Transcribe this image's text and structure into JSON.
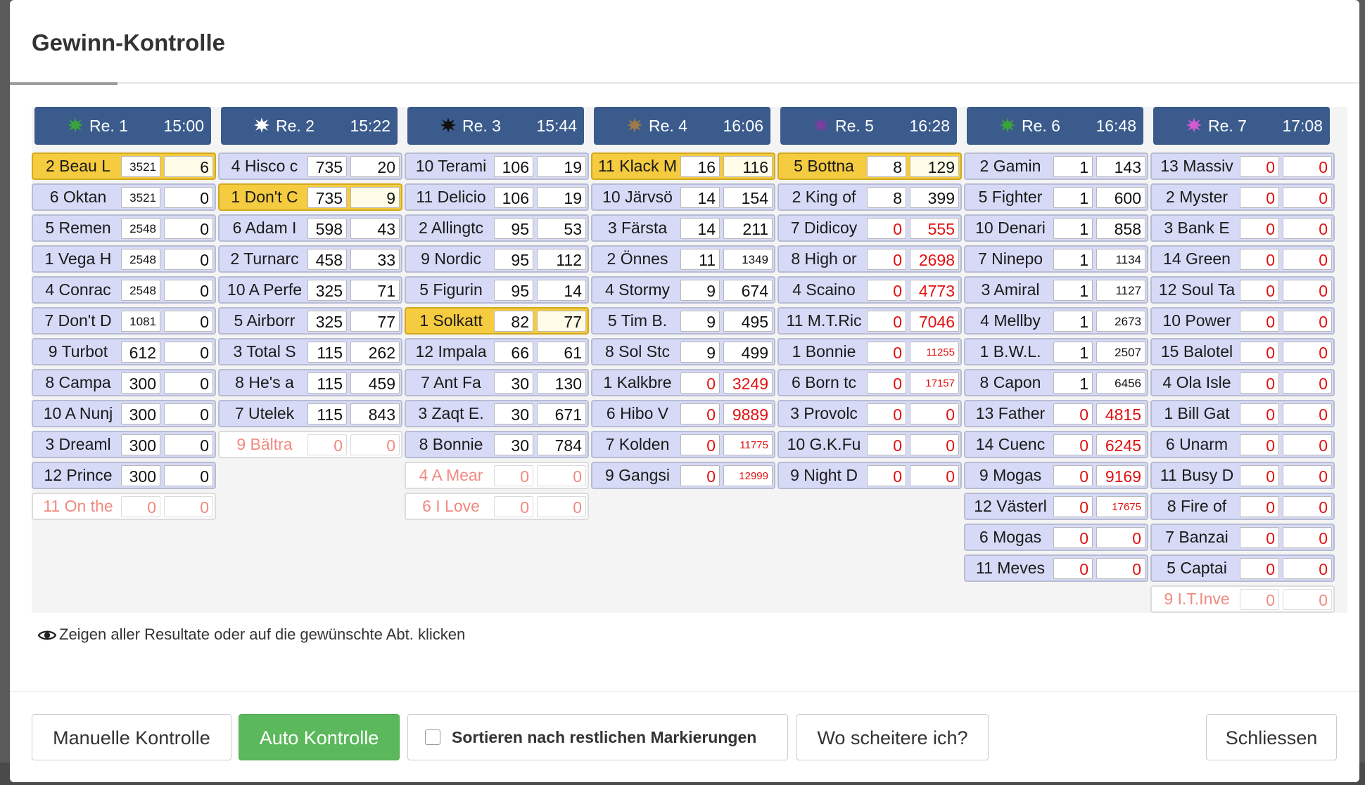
{
  "modal": {
    "title": "Gewinn-Kontrolle",
    "hint": "Zeigen aller Resultate oder auf die gewünschte Abt. klicken"
  },
  "races": [
    {
      "label": "Re. 1",
      "time": "15:00",
      "dot_color": "#3aa43a",
      "rows": [
        {
          "name": "2 Beau L",
          "v1": "3521",
          "v2": "6",
          "state": "winner"
        },
        {
          "name": "6 Oktan",
          "v1": "3521",
          "v2": "0",
          "state": "normal"
        },
        {
          "name": "5 Remen",
          "v1": "2548",
          "v2": "0",
          "state": "normal"
        },
        {
          "name": "1 Vega H",
          "v1": "2548",
          "v2": "0",
          "state": "normal"
        },
        {
          "name": "4 Conrac",
          "v1": "2548",
          "v2": "0",
          "state": "normal"
        },
        {
          "name": "7 Don't D",
          "v1": "1081",
          "v2": "0",
          "state": "normal"
        },
        {
          "name": "9 Turbot",
          "v1": "612",
          "v2": "0",
          "state": "normal"
        },
        {
          "name": "8 Campa",
          "v1": "300",
          "v2": "0",
          "state": "normal"
        },
        {
          "name": "10 A Nunj",
          "v1": "300",
          "v2": "0",
          "state": "normal"
        },
        {
          "name": "3 Dreaml",
          "v1": "300",
          "v2": "0",
          "state": "normal"
        },
        {
          "name": "12 Prince",
          "v1": "300",
          "v2": "0",
          "state": "normal"
        },
        {
          "name": "11 On the",
          "v1": "0",
          "v2": "0",
          "state": "scratched"
        }
      ]
    },
    {
      "label": "Re. 2",
      "time": "15:22",
      "dot_color": "#ffffff",
      "rows": [
        {
          "name": "4 Hisco c",
          "v1": "735",
          "v2": "20",
          "state": "normal"
        },
        {
          "name": "1 Don't C",
          "v1": "735",
          "v2": "9",
          "state": "winner"
        },
        {
          "name": "6 Adam I",
          "v1": "598",
          "v2": "43",
          "state": "normal"
        },
        {
          "name": "2 Turnarc",
          "v1": "458",
          "v2": "33",
          "state": "normal"
        },
        {
          "name": "10 A Perfe",
          "v1": "325",
          "v2": "71",
          "state": "normal"
        },
        {
          "name": "5 Airborr",
          "v1": "325",
          "v2": "77",
          "state": "normal"
        },
        {
          "name": "3 Total S",
          "v1": "115",
          "v2": "262",
          "state": "normal"
        },
        {
          "name": "8 He's a",
          "v1": "115",
          "v2": "459",
          "state": "normal"
        },
        {
          "name": "7 Utelek",
          "v1": "115",
          "v2": "843",
          "state": "normal"
        },
        {
          "name": "9 Bältra",
          "v1": "0",
          "v2": "0",
          "state": "scratched"
        }
      ]
    },
    {
      "label": "Re. 3",
      "time": "15:44",
      "dot_color": "#111111",
      "rows": [
        {
          "name": "10 Terami",
          "v1": "106",
          "v2": "19",
          "state": "normal"
        },
        {
          "name": "11 Delicio",
          "v1": "106",
          "v2": "19",
          "state": "normal"
        },
        {
          "name": "2 Allingtc",
          "v1": "95",
          "v2": "53",
          "state": "normal"
        },
        {
          "name": "9 Nordic",
          "v1": "95",
          "v2": "112",
          "state": "normal"
        },
        {
          "name": "5 Figurin",
          "v1": "95",
          "v2": "14",
          "state": "normal"
        },
        {
          "name": "1 Solkatt",
          "v1": "82",
          "v2": "77",
          "state": "winner"
        },
        {
          "name": "12 Impala",
          "v1": "66",
          "v2": "61",
          "state": "normal"
        },
        {
          "name": "7 Ant Fa",
          "v1": "30",
          "v2": "130",
          "state": "normal"
        },
        {
          "name": "3 Zaqt E.",
          "v1": "30",
          "v2": "671",
          "state": "normal"
        },
        {
          "name": "8 Bonnie",
          "v1": "30",
          "v2": "784",
          "state": "normal"
        },
        {
          "name": "4 A Mear",
          "v1": "0",
          "v2": "0",
          "state": "scratched"
        },
        {
          "name": "6 I Love",
          "v1": "0",
          "v2": "0",
          "state": "scratched"
        }
      ]
    },
    {
      "label": "Re. 4",
      "time": "16:06",
      "dot_color": "#9c7a4a",
      "rows": [
        {
          "name": "11 Klack M",
          "v1": "16",
          "v2": "116",
          "state": "winner"
        },
        {
          "name": "10 Järvsö",
          "v1": "14",
          "v2": "154",
          "state": "normal"
        },
        {
          "name": "3 Färsta",
          "v1": "14",
          "v2": "211",
          "state": "normal"
        },
        {
          "name": "2 Önnes",
          "v1": "11",
          "v2": "1349",
          "state": "normal"
        },
        {
          "name": "4 Stormy",
          "v1": "9",
          "v2": "674",
          "state": "normal"
        },
        {
          "name": "5 Tim B.",
          "v1": "9",
          "v2": "495",
          "state": "normal"
        },
        {
          "name": "8 Sol Stc",
          "v1": "9",
          "v2": "499",
          "state": "normal"
        },
        {
          "name": "1 Kalkbre",
          "v1": "0",
          "v2": "3249",
          "state": "normal"
        },
        {
          "name": "6 Hibo V",
          "v1": "0",
          "v2": "9889",
          "state": "normal"
        },
        {
          "name": "7 Kolden",
          "v1": "0",
          "v2": "11775",
          "state": "normal"
        },
        {
          "name": "9 Gangsi",
          "v1": "0",
          "v2": "12999",
          "state": "normal"
        }
      ]
    },
    {
      "label": "Re. 5",
      "time": "16:28",
      "dot_color": "#7b3fa0",
      "rows": [
        {
          "name": "5 Bottna",
          "v1": "8",
          "v2": "129",
          "state": "winner"
        },
        {
          "name": "2 King of",
          "v1": "8",
          "v2": "399",
          "state": "normal"
        },
        {
          "name": "7 Didicoy",
          "v1": "0",
          "v2": "555",
          "state": "normal"
        },
        {
          "name": "8 High or",
          "v1": "0",
          "v2": "2698",
          "state": "normal"
        },
        {
          "name": "4 Scaino",
          "v1": "0",
          "v2": "4773",
          "state": "normal"
        },
        {
          "name": "11 M.T.Ric",
          "v1": "0",
          "v2": "7046",
          "state": "normal"
        },
        {
          "name": "1 Bonnie",
          "v1": "0",
          "v2": "11255",
          "state": "normal"
        },
        {
          "name": "6 Born tc",
          "v1": "0",
          "v2": "17157",
          "state": "normal"
        },
        {
          "name": "3 Provolc",
          "v1": "0",
          "v2": "0",
          "state": "normal"
        },
        {
          "name": "10 G.K.Fu",
          "v1": "0",
          "v2": "0",
          "state": "normal"
        },
        {
          "name": "9 Night D",
          "v1": "0",
          "v2": "0",
          "state": "normal"
        }
      ]
    },
    {
      "label": "Re. 6",
      "time": "16:48",
      "dot_color": "#3aa43a",
      "rows": [
        {
          "name": "2 Gamin",
          "v1": "1",
          "v2": "143",
          "state": "normal"
        },
        {
          "name": "5 Fighter",
          "v1": "1",
          "v2": "600",
          "state": "normal"
        },
        {
          "name": "10 Denari",
          "v1": "1",
          "v2": "858",
          "state": "normal"
        },
        {
          "name": "7 Ninepo",
          "v1": "1",
          "v2": "1134",
          "state": "normal"
        },
        {
          "name": "3 Amiral",
          "v1": "1",
          "v2": "1127",
          "state": "normal"
        },
        {
          "name": "4 Mellby",
          "v1": "1",
          "v2": "2673",
          "state": "normal"
        },
        {
          "name": "1 B.W.L.",
          "v1": "1",
          "v2": "2507",
          "state": "normal"
        },
        {
          "name": "8 Capon",
          "v1": "1",
          "v2": "6456",
          "state": "normal"
        },
        {
          "name": "13 Father",
          "v1": "0",
          "v2": "4815",
          "state": "normal"
        },
        {
          "name": "14 Cuenc",
          "v1": "0",
          "v2": "6245",
          "state": "normal"
        },
        {
          "name": "9 Mogas",
          "v1": "0",
          "v2": "9169",
          "state": "normal"
        },
        {
          "name": "12 Västerl",
          "v1": "0",
          "v2": "17675",
          "state": "normal"
        },
        {
          "name": "6 Mogas",
          "v1": "0",
          "v2": "0",
          "state": "normal"
        },
        {
          "name": "11 Meves",
          "v1": "0",
          "v2": "0",
          "state": "normal"
        }
      ]
    },
    {
      "label": "Re. 7",
      "time": "17:08",
      "dot_color": "#d35ad3",
      "rows": [
        {
          "name": "13 Massiv",
          "v1": "0",
          "v2": "0",
          "state": "normal"
        },
        {
          "name": "2 Myster",
          "v1": "0",
          "v2": "0",
          "state": "normal"
        },
        {
          "name": "3 Bank E",
          "v1": "0",
          "v2": "0",
          "state": "normal"
        },
        {
          "name": "14 Green",
          "v1": "0",
          "v2": "0",
          "state": "normal"
        },
        {
          "name": "12 Soul Ta",
          "v1": "0",
          "v2": "0",
          "state": "normal"
        },
        {
          "name": "10 Power",
          "v1": "0",
          "v2": "0",
          "state": "normal"
        },
        {
          "name": "15 Balotel",
          "v1": "0",
          "v2": "0",
          "state": "normal"
        },
        {
          "name": "4 Ola Isle",
          "v1": "0",
          "v2": "0",
          "state": "normal"
        },
        {
          "name": "1 Bill Gat",
          "v1": "0",
          "v2": "0",
          "state": "normal"
        },
        {
          "name": "6 Unarm",
          "v1": "0",
          "v2": "0",
          "state": "normal"
        },
        {
          "name": "11 Busy D",
          "v1": "0",
          "v2": "0",
          "state": "normal"
        },
        {
          "name": "8 Fire of",
          "v1": "0",
          "v2": "0",
          "state": "normal"
        },
        {
          "name": "7 Banzai",
          "v1": "0",
          "v2": "0",
          "state": "normal"
        },
        {
          "name": "5 Captai",
          "v1": "0",
          "v2": "0",
          "state": "normal"
        },
        {
          "name": "9 I.T.Inve",
          "v1": "0",
          "v2": "0",
          "state": "scratched"
        }
      ]
    }
  ],
  "footer": {
    "manual_label": "Manuelle Kontrolle",
    "auto_label": "Auto Kontrolle",
    "sort_label": "Sortieren nach restlichen Markierungen",
    "sort_checked": false,
    "fail_label": "Wo scheitere ich?",
    "close_label": "Schliessen"
  },
  "colors": {
    "header_bg": "#3a5b8c",
    "row_bg": "#d7daf6",
    "winner_bg": "#f5cb3f",
    "scratched_text": "#f08a80",
    "zero_text": "#e01010",
    "auto_button": "#5cb85c"
  }
}
